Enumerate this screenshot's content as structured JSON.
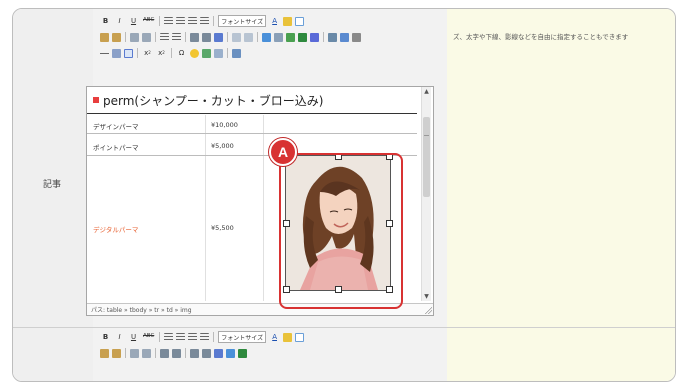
{
  "editor": {
    "field_label": "記事",
    "hint_text": "ズ、太字や下線、影線などを自由に指定することもできます",
    "toolbar": {
      "row1": [
        "B",
        "I",
        "U",
        "ABC"
      ],
      "font_size_select": "フォントサイズ",
      "text_color": "A",
      "path_label": "パス: table » tbody » tr » td » img"
    },
    "content": {
      "title": "perm(シャンプー・カット・ブロー込み)",
      "rows": [
        {
          "name": "デザインパーマ",
          "price": "¥10,000"
        },
        {
          "name": "ポイントパーマ",
          "price": "¥5,000"
        },
        {
          "name": "デジタルパーマ",
          "price": "¥5,500"
        }
      ]
    }
  },
  "annotation": {
    "marker_label": "A",
    "highlight_color": "#d83232"
  },
  "colors": {
    "title_bullet": "#e83e3e",
    "highlight_row_text": "#e86030",
    "hint_bg": "#fafae6"
  },
  "icons": [
    "bold-icon",
    "italic-icon",
    "underline-icon",
    "strikethrough-icon",
    "align-left-icon",
    "align-center-icon",
    "align-right-icon",
    "justify-icon",
    "text-color-icon",
    "highlight-icon",
    "paste-icon",
    "paste-text-icon",
    "find-icon",
    "replace-icon",
    "bullet-list-icon",
    "number-list-icon",
    "outdent-icon",
    "indent-icon",
    "blockquote-icon",
    "undo-icon",
    "redo-icon",
    "link-icon",
    "unlink-icon",
    "anchor-icon",
    "image-icon",
    "code-icon",
    "cleanup-icon",
    "help-icon",
    "hr-icon",
    "remove-format-icon",
    "table-icon",
    "subscript-icon",
    "superscript-icon",
    "special-char-icon",
    "emoticon-icon",
    "media-icon",
    "fullscreen-icon"
  ]
}
